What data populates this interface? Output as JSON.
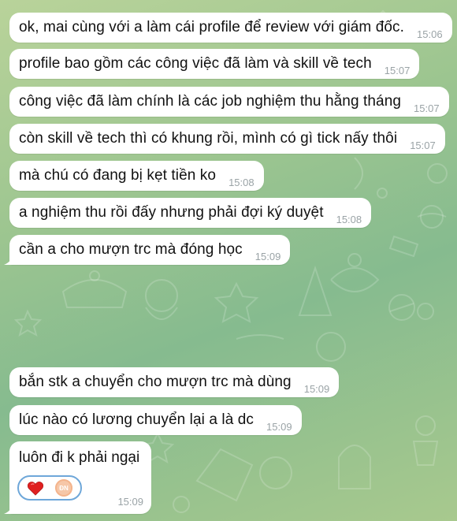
{
  "messages": [
    {
      "text": "ok, mai cùng với a làm cái profile để review với giám đốc.",
      "time": "15:06"
    },
    {
      "text": "profile bao gồm các công việc đã làm và skill về tech",
      "time": "15:07"
    },
    {
      "text": "công việc đã làm chính là các job nghiệm thu hằng tháng",
      "time": "15:07"
    },
    {
      "text": "còn skill về tech thì có khung rồi, mình có gì tick nấy thôi",
      "time": "15:07"
    },
    {
      "text": "mà chú có đang bị kẹt tiền ko",
      "time": "15:08"
    },
    {
      "text": "a nghiệm thu rồi đấy nhưng phải đợi ký duyệt",
      "time": "15:08"
    },
    {
      "text": "cần a cho mượn trc mà đóng học",
      "time": "15:09"
    },
    {
      "text": "bắn stk a chuyển cho mượn trc mà dùng",
      "time": "15:09"
    },
    {
      "text": "lúc nào có lương chuyển lại a là dc",
      "time": "15:09"
    },
    {
      "text": "luôn đi k phải ngại",
      "time": "15:09"
    }
  ],
  "reaction": {
    "emoji_icon": "red-heart-icon",
    "avatar_initials": "ĐN"
  },
  "colors": {
    "bubble": "#ffffff",
    "time": "#9aa3a6",
    "reaction_border": "#6ea7d9",
    "heart": "#e02020"
  }
}
